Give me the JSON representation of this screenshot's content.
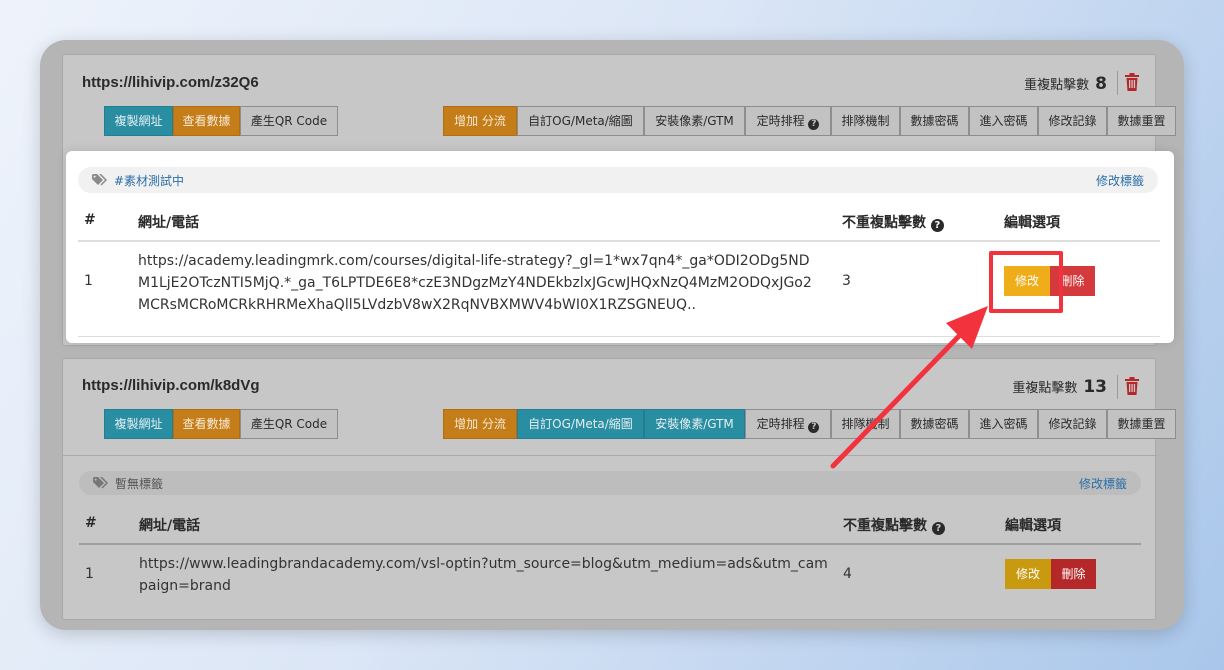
{
  "links": [
    {
      "short_url": "https://lihivip.com/z32Q6",
      "unique_clicks_label": "重複點擊數",
      "unique_clicks_count": "8",
      "tag": "#素材測試中",
      "edit_tag_label": "修改標籤",
      "table": {
        "headers": [
          "#",
          "網址/電話",
          "不重複點擊數",
          "編輯選項"
        ],
        "rows": [
          {
            "index": "1",
            "url": "https://academy.leadingmrk.com/courses/digital-life-strategy?_gl=1*wx7qn4*_ga*ODI2ODg5NDM1LjE2OTczNTI5MjQ.*_ga_T6LPTDE6E8*czE3NDgzMzY4NDEkbzlxJGcwJHQxNzQ4MzM2ODQxJGo2MCRsMCRoMCRkRHRMeXhaQll5LVdzbV8wX2RqNVBXMWV4bWI0X1RZSGNEUQ..",
            "clicks": "3",
            "edit_label": "修改",
            "delete_label": "刪除"
          }
        ]
      }
    },
    {
      "short_url": "https://lihivip.com/k8dVg",
      "unique_clicks_label": "重複點擊數",
      "unique_clicks_count": "13",
      "tag": "暫無標籤",
      "edit_tag_label": "修改標籤",
      "table": {
        "headers": [
          "#",
          "網址/電話",
          "不重複點擊數",
          "編輯選項"
        ],
        "rows": [
          {
            "index": "1",
            "url": "https://www.leadingbrandacademy.com/vsl-optin?utm_source=blog&utm_medium=ads&utm_campaign=brand",
            "clicks": "4",
            "edit_label": "修改",
            "delete_label": "刪除"
          }
        ]
      }
    }
  ],
  "toolbar": {
    "copy_url": "複製網址",
    "view_data": "查看數據",
    "qr_code": "產生QR Code",
    "add_split": "增加 分流",
    "og_meta": "自訂OG/Meta/縮圖",
    "pixel_gtm": "安裝像素/GTM",
    "schedule": "定時排程",
    "queue": "排隊機制",
    "data_password": "數據密碼",
    "enter_password": "進入密碼",
    "edit_log": "修改記錄",
    "reset_data": "數據重置"
  },
  "colors": {
    "teal": "#2a8ea3",
    "orange": "#c57d1a",
    "edit_yellow": "#f0ad1a",
    "delete_red": "#d4393c",
    "highlight_red": "#f2323c"
  }
}
